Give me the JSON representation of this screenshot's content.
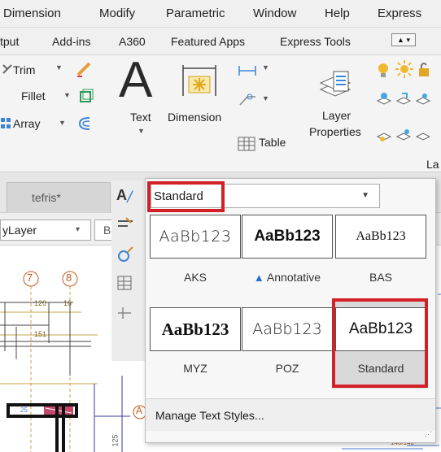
{
  "menu": {
    "items": [
      "Dimension",
      "Modify",
      "Parametric",
      "Window",
      "Help",
      "Express"
    ]
  },
  "tabs": {
    "items": [
      "tput",
      "Add-ins",
      "A360",
      "Featured Apps",
      "Express Tools"
    ]
  },
  "ribbon": {
    "trim": "Trim",
    "fillet": "Fillet",
    "array": "Array",
    "text": "Text",
    "dimension": "Dimension",
    "table": "Table",
    "layer_line1": "Layer",
    "layer_line2": "Properties",
    "la": "La"
  },
  "doc_tab": "tefris*",
  "layer_combo": "yLayer",
  "layer_combo_cut": "B",
  "drawing": {
    "bubble7": "7",
    "bubble8": "8",
    "bubbleA": "A",
    "dim120": "120",
    "dim151": "151",
    "dim125": "125",
    "dim16": "16",
    "dim140": "140/140",
    "dimRed": "25"
  },
  "style_panel": {
    "current": "Standard",
    "sample": "AaBb123",
    "styles": [
      {
        "name": "AKS",
        "sample": "AaBb123"
      },
      {
        "name": "Annotative",
        "sample": "AaBb123"
      },
      {
        "name": "BAS",
        "sample": "AaBb123"
      },
      {
        "name": "MYZ",
        "sample": "AaBb123"
      },
      {
        "name": "POZ",
        "sample": "AaBb123"
      },
      {
        "name": "Standard",
        "sample": "AaBb123"
      }
    ],
    "manage": "Manage Text Styles...",
    "accent_red": "#d32027",
    "annotative_blue": "#1e6fd9"
  }
}
